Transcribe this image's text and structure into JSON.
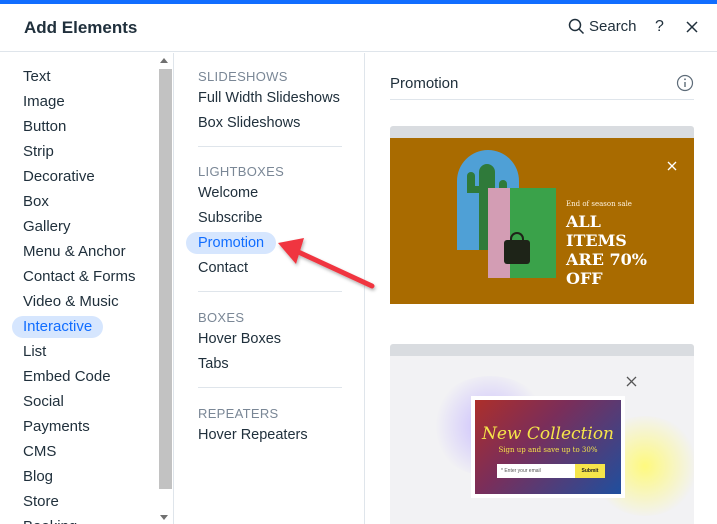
{
  "header": {
    "title": "Add Elements",
    "search_label": "Search",
    "help_label": "?"
  },
  "categories": [
    {
      "label": "Text"
    },
    {
      "label": "Image"
    },
    {
      "label": "Button"
    },
    {
      "label": "Strip"
    },
    {
      "label": "Decorative"
    },
    {
      "label": "Box"
    },
    {
      "label": "Gallery"
    },
    {
      "label": "Menu & Anchor"
    },
    {
      "label": "Contact & Forms"
    },
    {
      "label": "Video & Music"
    },
    {
      "label": "Interactive",
      "selected": true
    },
    {
      "label": "List"
    },
    {
      "label": "Embed Code"
    },
    {
      "label": "Social"
    },
    {
      "label": "Payments"
    },
    {
      "label": "CMS"
    },
    {
      "label": "Blog"
    },
    {
      "label": "Store"
    },
    {
      "label": "Booking"
    }
  ],
  "subcategories": {
    "slideshows": {
      "title": "SLIDESHOWS",
      "items": [
        "Full Width Slideshows",
        "Box Slideshows"
      ]
    },
    "lightboxes": {
      "title": "LIGHTBOXES",
      "items": [
        "Welcome",
        "Subscribe",
        "Promotion",
        "Contact"
      ],
      "selected": "Promotion"
    },
    "boxes": {
      "title": "BOXES",
      "items": [
        "Hover Boxes",
        "Tabs"
      ]
    },
    "repeaters": {
      "title": "REPEATERS",
      "items": [
        "Hover Repeaters"
      ]
    }
  },
  "panel": {
    "title": "Promotion",
    "card1": {
      "small_text": "End of season sale",
      "big_text": "ALL ITEMS ARE 70% OFF"
    },
    "card2": {
      "headline": "New Collection",
      "subline": "Sign up and save up to 30%",
      "email_placeholder": "* Enter your email",
      "submit_label": "Submit"
    }
  },
  "colors": {
    "accent": "#116dff",
    "selected_bg": "#d6e6fe",
    "promo_bg": "#a96b00",
    "arrow": "#f0363f"
  }
}
